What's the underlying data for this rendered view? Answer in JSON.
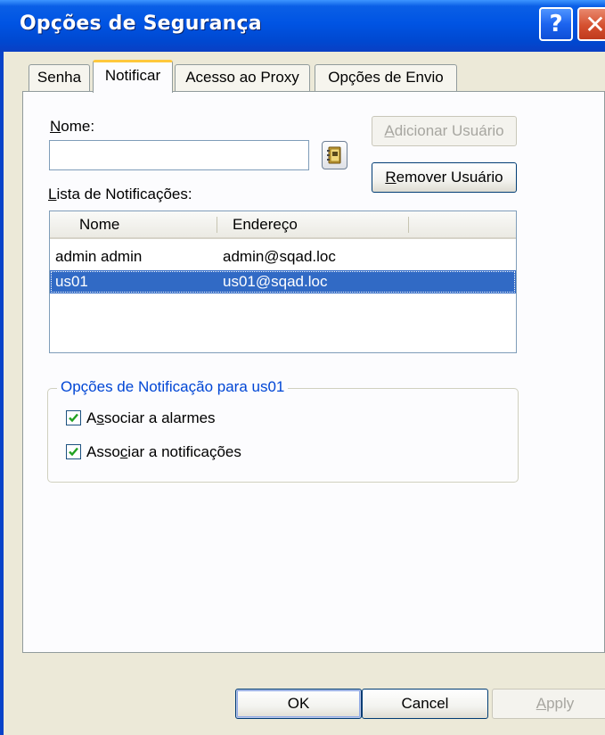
{
  "window": {
    "title": "Opções de Segurança",
    "help_button": "?",
    "close_button": "✕"
  },
  "tabs": [
    {
      "label": "Senha",
      "active": false
    },
    {
      "label": "Notificar",
      "active": true
    },
    {
      "label": "Acesso ao Proxy",
      "active": false
    },
    {
      "label": "Opções de Envio",
      "active": false
    }
  ],
  "form": {
    "name_label_mnemonic": "N",
    "name_label_rest": "ome:",
    "name_value": "",
    "add_user_mnemonic": "A",
    "add_user_rest": "dicionar Usuário",
    "remove_user_mnemonic": "R",
    "remove_user_rest": "emover Usuário",
    "address_book_icon": "address-book-icon"
  },
  "notification_list": {
    "label_mnemonic": "L",
    "label_rest": "ista de Notificações:",
    "columns": [
      "Nome",
      "Endereço"
    ],
    "rows": [
      {
        "name": "admin admin",
        "address": "admin@sqad.loc",
        "selected": false
      },
      {
        "name": "us01",
        "address": "us01@sqad.loc",
        "selected": true
      }
    ]
  },
  "notification_options": {
    "title": "Opções de Notificação para us01",
    "alarms_pre": "A",
    "alarms_mnemonic": "s",
    "alarms_post": "sociar a alarmes",
    "alarms_checked": true,
    "notifs_pre": "Asso",
    "notifs_mnemonic": "c",
    "notifs_post": "iar a notificações",
    "notifs_checked": true
  },
  "footer": {
    "ok_label": "OK",
    "cancel_label": "Cancel",
    "apply_mnemonic": "A",
    "apply_rest": "pply"
  },
  "colors": {
    "title_bar": "#0054e3",
    "selection": "#316ac5",
    "group_title": "#0046d5",
    "active_tab_highlight": "#ffc83c"
  }
}
